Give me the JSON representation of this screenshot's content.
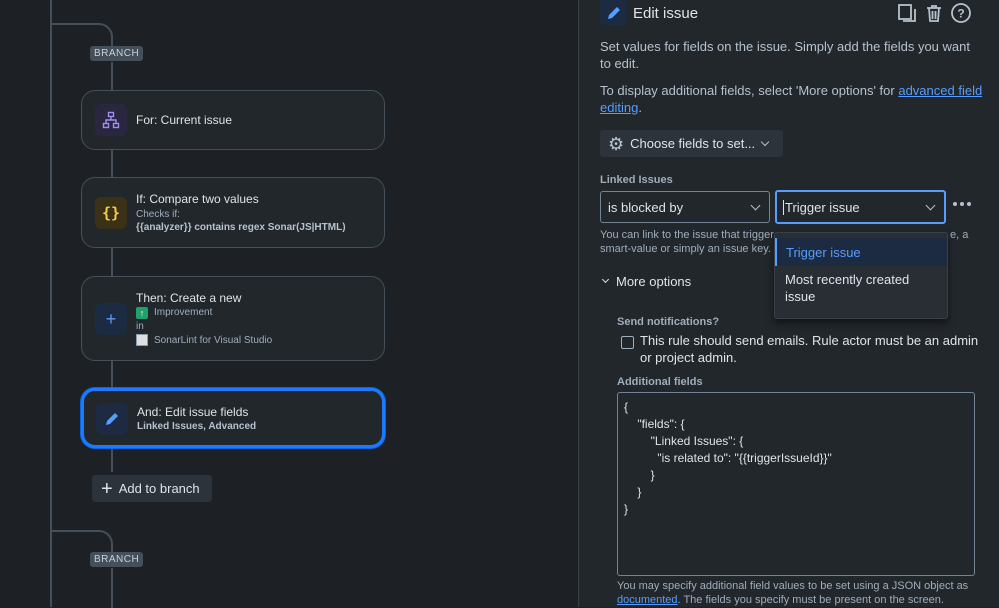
{
  "canvas": {
    "branch_label_1": "BRANCH",
    "branch_label_2": "BRANCH",
    "cards": [
      {
        "title": "For: Current issue",
        "icon": "branch-icon"
      },
      {
        "title": "If: Compare two values",
        "checks": "Checks if:",
        "detail": "{{analyzer}} contains regex Sonar(JS|HTML)",
        "icon": "curly-braces-icon"
      },
      {
        "title": "Then: Create a new",
        "type": "Improvement",
        "in": "in",
        "project": "SonarLint for Visual Studio",
        "icon": "plus-icon"
      },
      {
        "title": "And: Edit issue fields",
        "detail": "Linked Issues, Advanced",
        "icon": "pencil-icon"
      }
    ],
    "add_to_branch": "Add to branch"
  },
  "panel": {
    "title": "Edit issue",
    "description": "Set values for fields on the issue. Simply add the fields you want to edit.",
    "advanced_prefix": "To display additional fields, select 'More options' for ",
    "advanced_link": "advanced field editing",
    "advanced_suffix": ".",
    "choose_fields": "Choose fields to set...",
    "linked_issues_label": "Linked Issues",
    "link_type": "is blocked by",
    "target": "Trigger issue",
    "helper_start": "You can link to the issue that trigger",
    "helper_end": "e, a",
    "helper_line2": "smart-value or simply an issue key.",
    "dropdown_options": [
      "Trigger issue",
      "Most recently created issue"
    ],
    "more_options": "More options",
    "send_notifications_label": "Send notifications?",
    "send_notifications_text": "This rule should send emails. Rule actor must be an admin or project admin.",
    "additional_fields_label": "Additional fields",
    "json_lines": [
      "{",
      "    \"fields\": {",
      "        \"Linked Issues\": {",
      "          \"is related to\": \"{{triggerIssueId}}\"",
      "        }",
      "    }",
      "}"
    ],
    "footer_prefix": "You may specify additional field values to be set using a JSON object as",
    "footer_link": "documented",
    "footer_suffix": ". The fields you specify must be present on the screen."
  },
  "colors": {
    "accent": "#579dff",
    "background": "#1d2125",
    "panel": "#22272b"
  }
}
